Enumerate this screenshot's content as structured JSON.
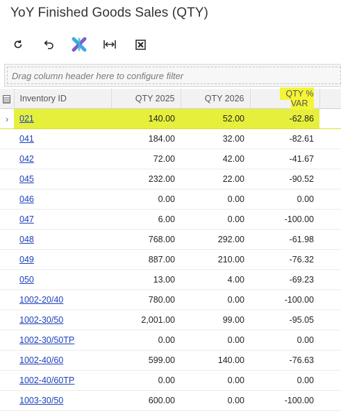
{
  "page": {
    "title": "YoY Finished Goods Sales (QTY)"
  },
  "toolbar": {
    "buttons": [
      {
        "name": "refresh-icon"
      },
      {
        "name": "undo-icon"
      },
      {
        "name": "fit-columns-icon"
      },
      {
        "name": "adjust-columns-width-icon"
      },
      {
        "name": "export-excel-icon"
      }
    ]
  },
  "grid": {
    "group_placeholder": "Drag column header here to configure filter",
    "headers": {
      "inventory_id": "Inventory ID",
      "qty_2025": "QTY 2025",
      "qty_2026": "QTY 2026",
      "qty_var": "QTY % VAR"
    },
    "highlight_color": "#f4f536",
    "rows": [
      {
        "id": "021",
        "q2025": "140.00",
        "q2026": "52.00",
        "var": "-62.86"
      },
      {
        "id": "041",
        "q2025": "184.00",
        "q2026": "32.00",
        "var": "-82.61"
      },
      {
        "id": "042",
        "q2025": "72.00",
        "q2026": "42.00",
        "var": "-41.67"
      },
      {
        "id": "045",
        "q2025": "232.00",
        "q2026": "22.00",
        "var": "-90.52"
      },
      {
        "id": "046",
        "q2025": "0.00",
        "q2026": "0.00",
        "var": "0.00"
      },
      {
        "id": "047",
        "q2025": "6.00",
        "q2026": "0.00",
        "var": "-100.00"
      },
      {
        "id": "048",
        "q2025": "768.00",
        "q2026": "292.00",
        "var": "-61.98"
      },
      {
        "id": "049",
        "q2025": "887.00",
        "q2026": "210.00",
        "var": "-76.32"
      },
      {
        "id": "050",
        "q2025": "13.00",
        "q2026": "4.00",
        "var": "-69.23"
      },
      {
        "id": "1002-20/40",
        "q2025": "780.00",
        "q2026": "0.00",
        "var": "-100.00"
      },
      {
        "id": "1002-30/50",
        "q2025": "2,001.00",
        "q2026": "99.00",
        "var": "-95.05"
      },
      {
        "id": "1002-30/50TP",
        "q2025": "0.00",
        "q2026": "0.00",
        "var": "0.00"
      },
      {
        "id": "1002-40/60",
        "q2025": "599.00",
        "q2026": "140.00",
        "var": "-76.63"
      },
      {
        "id": "1002-40/60TP",
        "q2025": "0.00",
        "q2026": "0.00",
        "var": "0.00"
      },
      {
        "id": "1003-30/50",
        "q2025": "600.00",
        "q2026": "0.00",
        "var": "-100.00"
      }
    ]
  }
}
